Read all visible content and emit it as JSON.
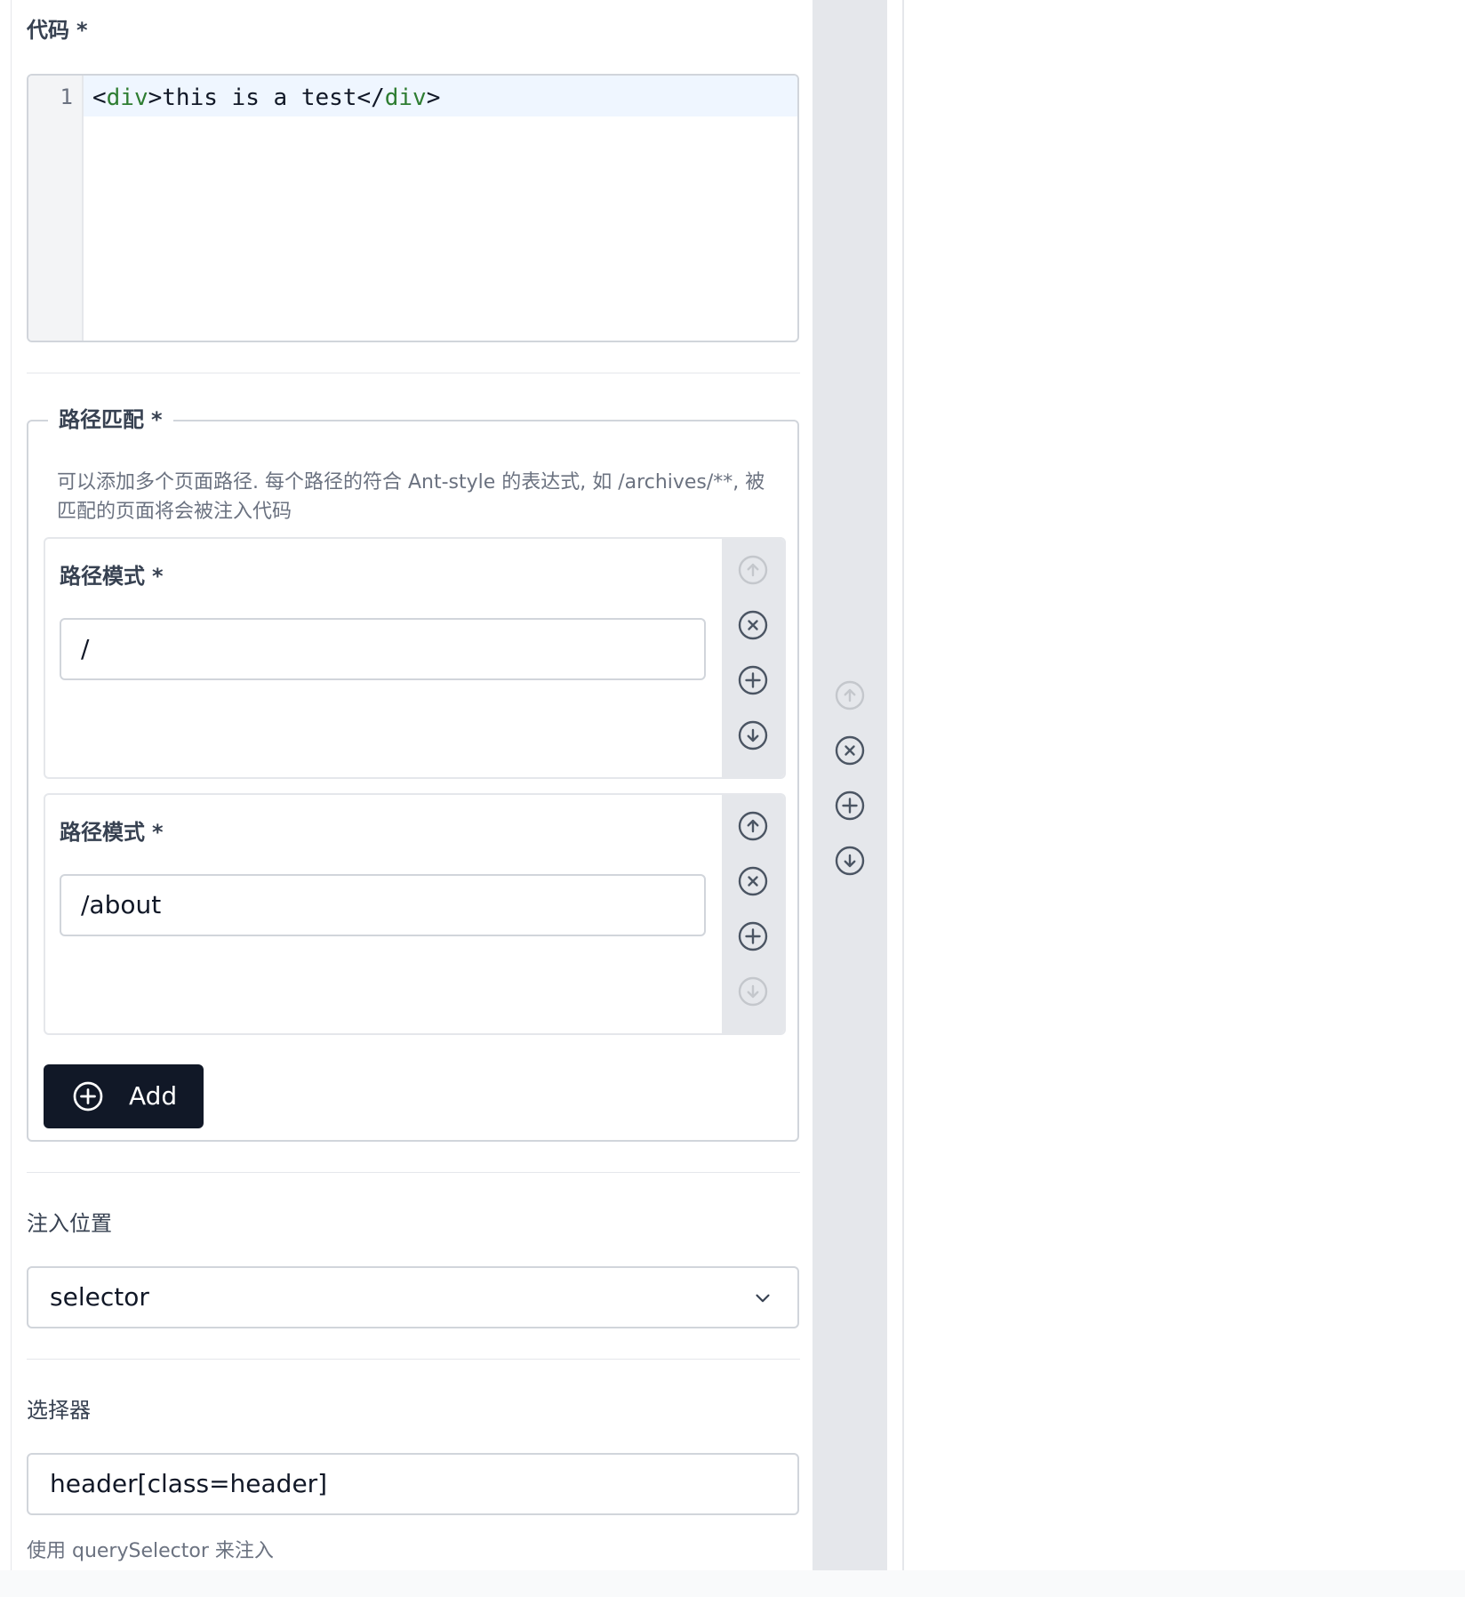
{
  "code_field": {
    "label": "代码",
    "required_mark": "*",
    "line_number": "1",
    "code_open_lt": "<",
    "code_open_tag": "div",
    "code_open_gt": ">",
    "code_text": "this is a test",
    "code_close_lt": "</",
    "code_close_tag": "div",
    "code_close_gt": ">"
  },
  "path_match": {
    "legend": "路径匹配",
    "required_mark": "*",
    "help": "可以添加多个页面路径. 每个路径的符合 Ant-style 的表达式, 如 /archives/**, 被匹配的页面将会被注入代码",
    "items": [
      {
        "label": "路径模式",
        "required_mark": "*",
        "value": "/",
        "actions": {
          "move_up_disabled": true,
          "move_down_disabled": false
        }
      },
      {
        "label": "路径模式",
        "required_mark": "*",
        "value": "/about",
        "actions": {
          "move_up_disabled": false,
          "move_down_disabled": true
        }
      }
    ],
    "add_button_label": "Add"
  },
  "injection_position": {
    "label": "注入位置",
    "selected": "selector"
  },
  "selector_field": {
    "label": "选择器",
    "value": "header[class=header]",
    "help": "使用 querySelector 来注入"
  },
  "outer_actions": {
    "move_up_disabled": true,
    "move_down_disabled": false
  },
  "colors": {
    "primary_button": "#111827",
    "border": "#d1d5db",
    "action_column": "#e5e7eb",
    "code_tag": "#2e7d32",
    "help_text": "#6b7280"
  },
  "icons": {
    "move_up": "arrow-up-circle-icon",
    "remove": "x-circle-icon",
    "add": "plus-circle-icon",
    "move_down": "arrow-down-circle-icon",
    "dropdown": "chevron-down-icon"
  }
}
